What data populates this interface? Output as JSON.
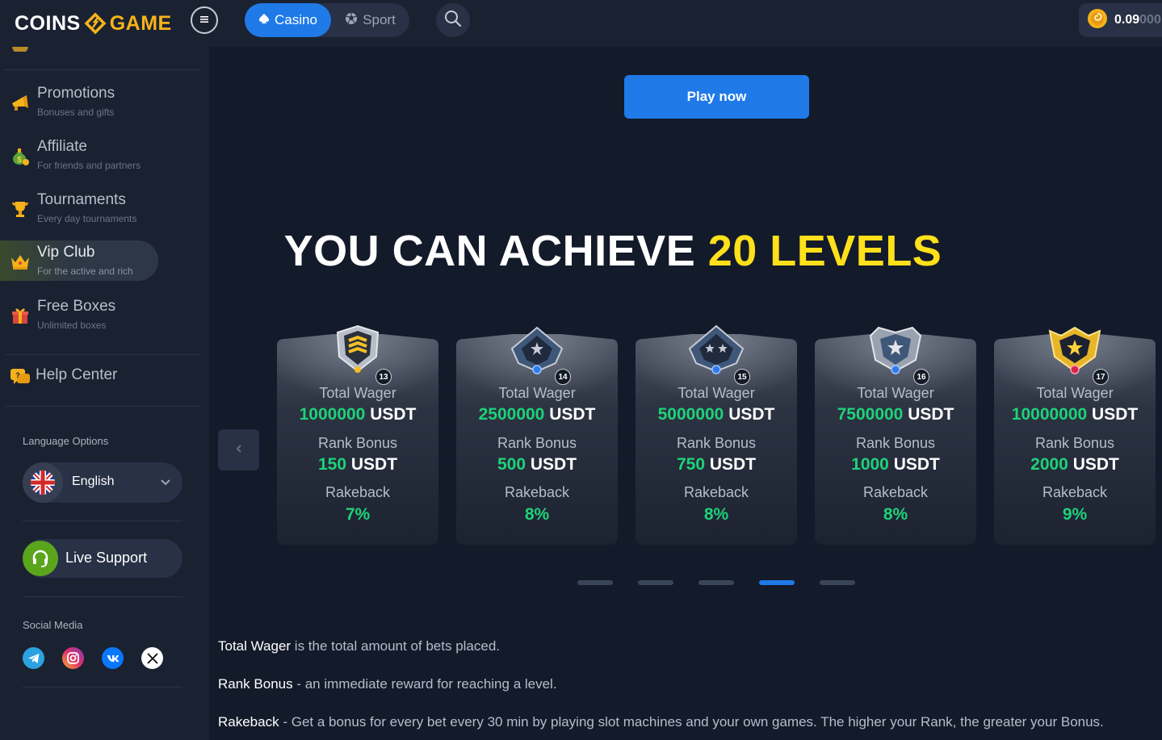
{
  "header": {
    "logo_left": "COINS",
    "logo_right": "GAME",
    "menu_icon": "menu-icon",
    "tabs": [
      {
        "label": "Casino",
        "active": true
      },
      {
        "label": "Sport",
        "active": false
      }
    ],
    "balance_value": "0.09",
    "balance_faded": "000"
  },
  "sidebar": {
    "items": [
      {
        "title": "Promotions",
        "subtitle": "Bonuses and gifts",
        "icon": "megaphone-icon"
      },
      {
        "title": "Affiliate",
        "subtitle": "For friends and partners",
        "icon": "money-bag-icon"
      },
      {
        "title": "Tournaments",
        "subtitle": "Every day tournaments",
        "icon": "trophy-icon"
      },
      {
        "title": "Vip Club",
        "subtitle": "For the active and rich",
        "icon": "crown-icon",
        "active": true
      },
      {
        "title": "Free Boxes",
        "subtitle": "Unlimited boxes",
        "icon": "gift-box-icon"
      }
    ],
    "help_label": "Help Center",
    "language_label": "Language Options",
    "language_value": "English",
    "live_support_label": "Live Support",
    "social_label": "Social Media",
    "socials": [
      "telegram-icon",
      "instagram-icon",
      "vk-icon",
      "x-icon"
    ]
  },
  "main": {
    "play_button": "Play now",
    "headline_white": "YOU CAN ACHIEVE ",
    "headline_yellow": "20 LEVELS",
    "cards": [
      {
        "level": "13",
        "wager_label": "Total Wager",
        "wager_amount": "1000000",
        "wager_unit": " USDT",
        "bonus_label": "Rank Bonus",
        "bonus_amount": "150",
        "bonus_unit": " USDT",
        "rakeback_label": "Rakeback",
        "rakeback": "7%",
        "badge": "gold-chevron-badge-icon"
      },
      {
        "level": "14",
        "wager_label": "Total Wager",
        "wager_amount": "2500000",
        "wager_unit": " USDT",
        "bonus_label": "Rank Bonus",
        "bonus_amount": "500",
        "bonus_unit": " USDT",
        "rakeback_label": "Rakeback",
        "rakeback": "8%",
        "badge": "one-star-badge-icon"
      },
      {
        "level": "15",
        "wager_label": "Total Wager",
        "wager_amount": "5000000",
        "wager_unit": " USDT",
        "bonus_label": "Rank Bonus",
        "bonus_amount": "750",
        "bonus_unit": " USDT",
        "rakeback_label": "Rakeback",
        "rakeback": "8%",
        "badge": "two-star-badge-icon"
      },
      {
        "level": "16",
        "wager_label": "Total Wager",
        "wager_amount": "7500000",
        "wager_unit": " USDT",
        "bonus_label": "Rank Bonus",
        "bonus_amount": "1000",
        "bonus_unit": " USDT",
        "rakeback_label": "Rakeback",
        "rakeback": "8%",
        "badge": "silver-star-badge-icon"
      },
      {
        "level": "17",
        "wager_label": "Total Wager",
        "wager_amount": "10000000",
        "wager_unit": " USDT",
        "bonus_label": "Rank Bonus",
        "bonus_amount": "2000",
        "bonus_unit": " USDT",
        "rakeback_label": "Rakeback",
        "rakeback": "9%",
        "badge": "gold-star-badge-icon"
      }
    ],
    "carousel_active_index": 3,
    "carousel_page_count": 5,
    "descriptions": [
      {
        "term": "Total Wager",
        "text": " is the total amount of bets placed."
      },
      {
        "term": "Rank Bonus",
        "text": " - an immediate reward for reaching a level."
      },
      {
        "term": "Rakeback",
        "text": " - Get a bonus for every bet every 30 min by playing slot machines and your own games. The higher your Rank, the greater your Bonus."
      }
    ]
  },
  "colors": {
    "accent": "#1f7ae8",
    "headline_yellow": "#ffe01a",
    "value_green": "#1ed27a",
    "background": "#131a2a",
    "sidebar": "#1a2232"
  }
}
